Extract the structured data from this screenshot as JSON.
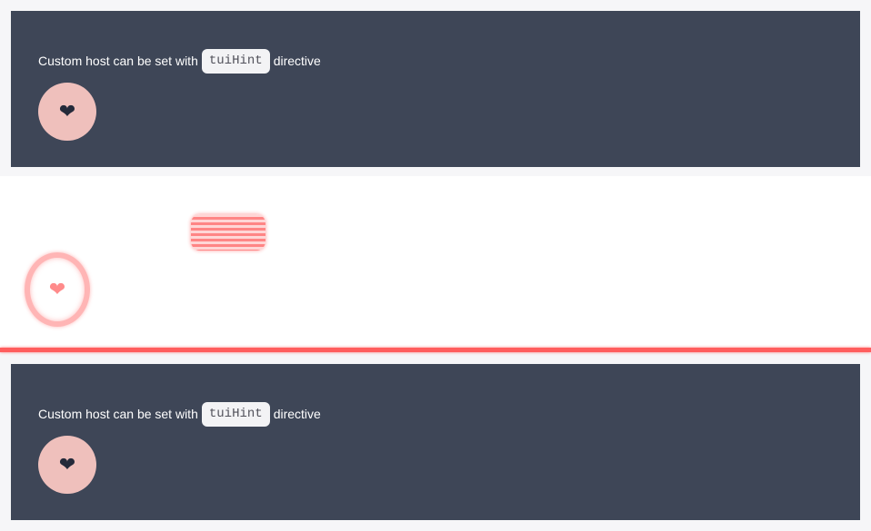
{
  "demo_top": {
    "caption_before": "Custom host can be set with",
    "code": "tuiHint",
    "caption_after": "directive",
    "button_icon": "❤"
  },
  "demo_bottom": {
    "caption_before": "Custom host can be set with",
    "code": "tuiHint",
    "caption_after": "directive",
    "button_icon": "❤"
  },
  "ghost": {
    "circle_icon": "❤"
  },
  "colors": {
    "panel_bg": "#3e4657",
    "button_bg": "#efc0bc",
    "divider": "#ff5d5d"
  },
  "icons": [
    "heart-icon"
  ]
}
